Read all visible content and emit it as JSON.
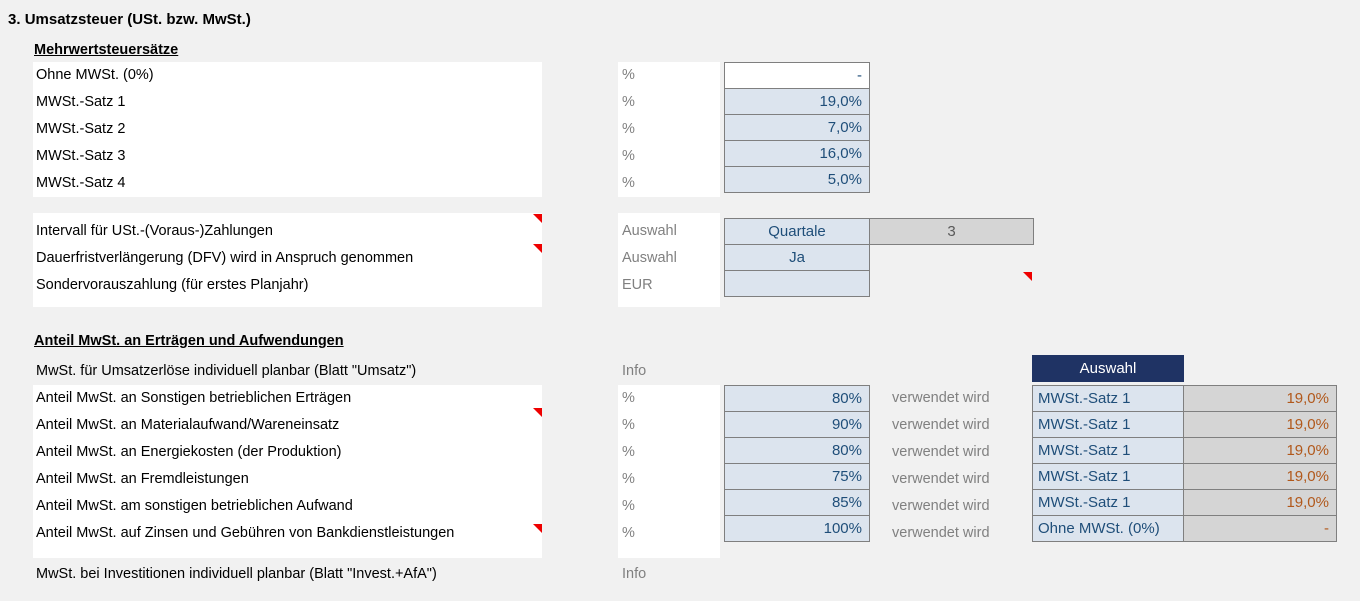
{
  "section": {
    "number": "3.",
    "title": "Umsatzsteuer (USt. bzw. MwSt.)"
  },
  "groups": {
    "rates_title": "Mehrwertsteuersätze",
    "share_title": "Anteil MwSt. an Erträgen und Aufwendungen"
  },
  "units": {
    "percent": "%",
    "eur": "EUR",
    "auswahl": "Auswahl",
    "info": "Info"
  },
  "rates": [
    {
      "label": "Ohne MWSt. (0%)",
      "unit": "%",
      "value": "-",
      "style": "white"
    },
    {
      "label": "MWSt.-Satz 1",
      "unit": "%",
      "value": "19,0%",
      "style": "blue"
    },
    {
      "label": "MWSt.-Satz 2",
      "unit": "%",
      "value": "7,0%",
      "style": "blue"
    },
    {
      "label": "MWSt.-Satz 3",
      "unit": "%",
      "value": "16,0%",
      "style": "blue"
    },
    {
      "label": "MWSt.-Satz 4",
      "unit": "%",
      "value": "5,0%",
      "style": "blue"
    }
  ],
  "payment_settings": [
    {
      "label": "Intervall für USt.-(Voraus-)Zahlungen",
      "unit": "Auswahl",
      "value": "Quartale",
      "extra": "3",
      "has_comment": true
    },
    {
      "label": "Dauerfristverlängerung (DFV) wird in Anspruch genommen",
      "unit": "Auswahl",
      "value": "Ja",
      "extra": "",
      "has_comment": true
    },
    {
      "label": "Sondervorauszahlung (für erstes Planjahr)",
      "unit": "EUR",
      "value": "",
      "extra": "",
      "has_comment": false
    }
  ],
  "share_info_top": {
    "label": "MwSt. für Umsatzerlöse individuell planbar (Blatt \"Umsatz\")",
    "unit": "Info"
  },
  "share_info_bottom": {
    "label": "MwSt. bei Investitionen individuell planbar (Blatt \"Invest.+AfA\")",
    "unit": "Info"
  },
  "share_note": "verwendet wird",
  "share_table_header": "Auswahl",
  "shares": [
    {
      "label": "Anteil MwSt. an Sonstigen betrieblichen Erträgen",
      "unit": "%",
      "value": "80%",
      "note": "verwendet wird",
      "selection": "MWSt.-Satz 1",
      "rate": "19,0%",
      "has_comment": false
    },
    {
      "label": "Anteil MwSt. an Materialaufwand/Wareneinsatz",
      "unit": "%",
      "value": "90%",
      "note": "verwendet wird",
      "selection": "MWSt.-Satz 1",
      "rate": "19,0%",
      "has_comment": true
    },
    {
      "label": "Anteil MwSt. an Energiekosten (der Produktion)",
      "unit": "%",
      "value": "80%",
      "note": "verwendet wird",
      "selection": "MWSt.-Satz 1",
      "rate": "19,0%",
      "has_comment": false
    },
    {
      "label": "Anteil MwSt. an Fremdleistungen",
      "unit": "%",
      "value": "75%",
      "note": "verwendet wird",
      "selection": "MWSt.-Satz 1",
      "rate": "19,0%",
      "has_comment": false
    },
    {
      "label": "Anteil MwSt. am sonstigen betrieblichen Aufwand",
      "unit": "%",
      "value": "85%",
      "note": "verwendet wird",
      "selection": "MWSt.-Satz 1",
      "rate": "19,0%",
      "has_comment": false
    },
    {
      "label": "Anteil MwSt. auf Zinsen und Gebühren von Bankdienstleistungen",
      "unit": "%",
      "value": "100%",
      "note": "verwendet wird",
      "selection": "Ohne MWSt. (0%)",
      "rate": "-",
      "has_comment": true
    }
  ],
  "colors": {
    "background": "#f1f1f1",
    "input_blue": "#dce4ee",
    "input_text": "#1f4e79",
    "grey_cell": "#d5d5d5",
    "navy_header": "#1f3364",
    "orange_text": "#b1581b",
    "muted_text": "#808080",
    "comment_marker": "#ee0000"
  }
}
